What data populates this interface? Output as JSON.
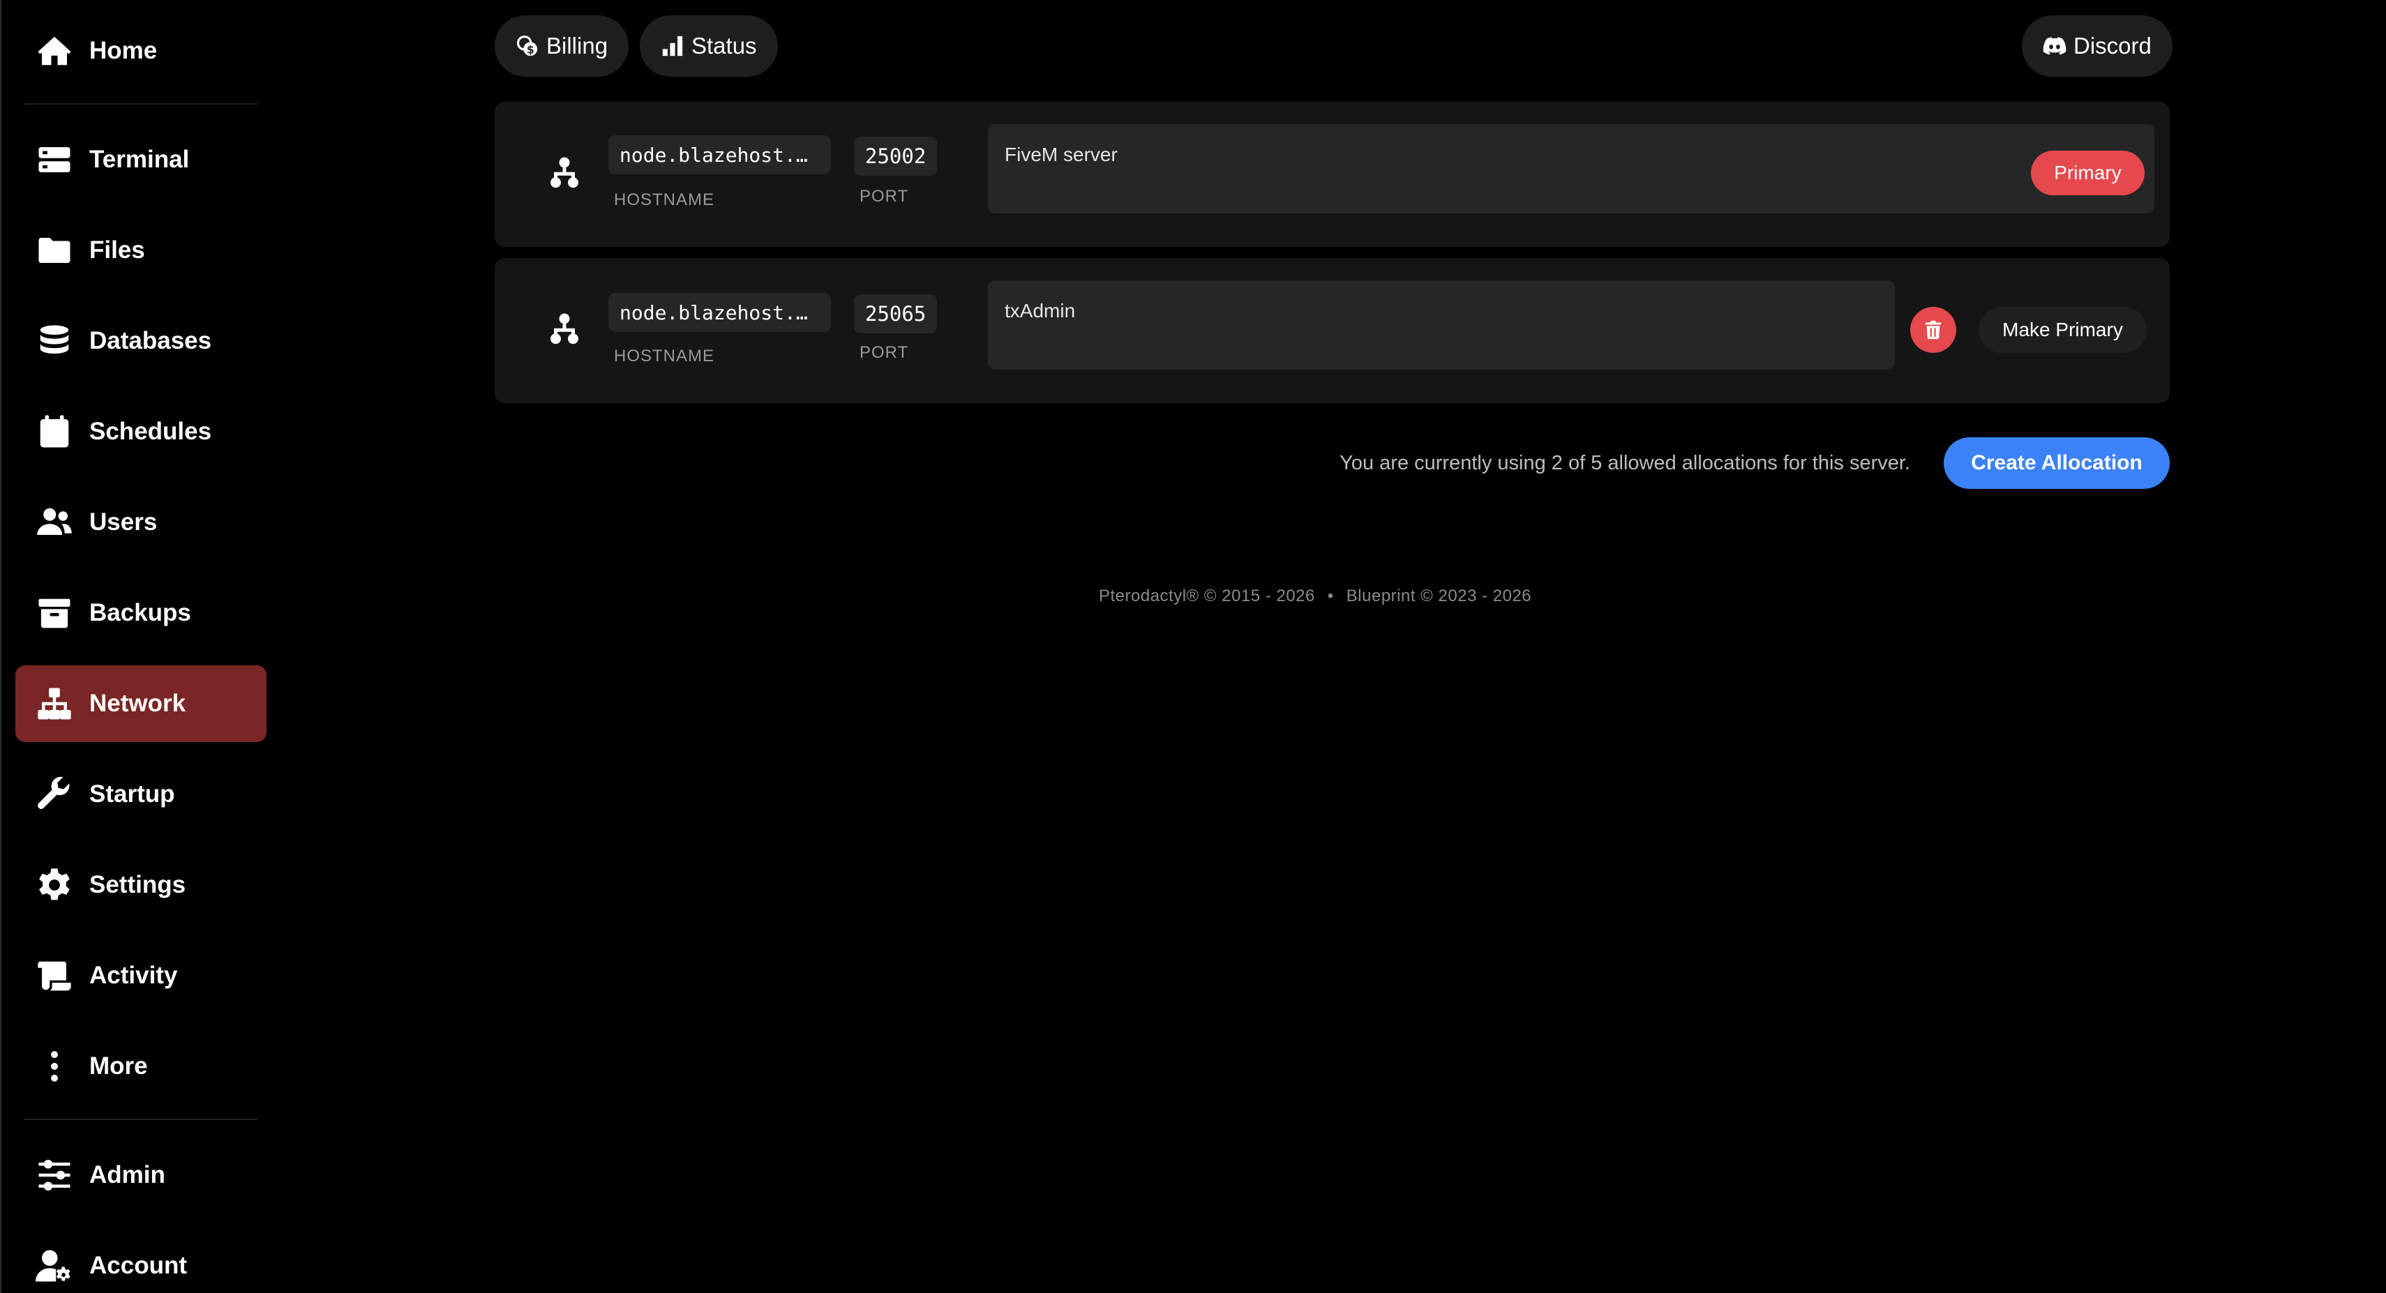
{
  "sidebar": {
    "items": [
      {
        "label": "Home",
        "icon": "home-icon"
      },
      {
        "label": "Terminal",
        "icon": "terminal-icon"
      },
      {
        "label": "Files",
        "icon": "folder-icon"
      },
      {
        "label": "Databases",
        "icon": "database-icon"
      },
      {
        "label": "Schedules",
        "icon": "calendar-icon"
      },
      {
        "label": "Users",
        "icon": "users-icon"
      },
      {
        "label": "Backups",
        "icon": "archive-icon"
      },
      {
        "label": "Network",
        "icon": "network-icon",
        "active": true
      },
      {
        "label": "Startup",
        "icon": "wrench-icon"
      },
      {
        "label": "Settings",
        "icon": "gear-icon"
      },
      {
        "label": "Activity",
        "icon": "scroll-icon"
      },
      {
        "label": "More",
        "icon": "ellipsis-vertical-icon"
      },
      {
        "label": "Admin",
        "icon": "sliders-icon"
      },
      {
        "label": "Account",
        "icon": "user-gear-icon"
      }
    ]
  },
  "topbar": {
    "billing_label": "Billing",
    "status_label": "Status",
    "discord_label": "Discord"
  },
  "allocations": [
    {
      "hostname": "node.blazehost.…",
      "hostname_label": "HOSTNAME",
      "port": "25002",
      "port_label": "PORT",
      "notes": "FiveM server",
      "primary_label": "Primary"
    },
    {
      "hostname": "node.blazehost.…",
      "hostname_label": "HOSTNAME",
      "port": "25065",
      "port_label": "PORT",
      "notes": "txAdmin",
      "make_primary_label": "Make Primary"
    }
  ],
  "allocation_info": "You are currently using 2 of 5 allowed allocations for this server.",
  "create_allocation_label": "Create Allocation",
  "footer": {
    "pterodactyl": "Pterodactyl® © 2015 - 2026",
    "separator": "•",
    "blueprint": "Blueprint © 2023 - 2026"
  },
  "colors": {
    "active_nav": "#7a2626",
    "danger": "#e5484d",
    "accent": "#3b82f6"
  }
}
